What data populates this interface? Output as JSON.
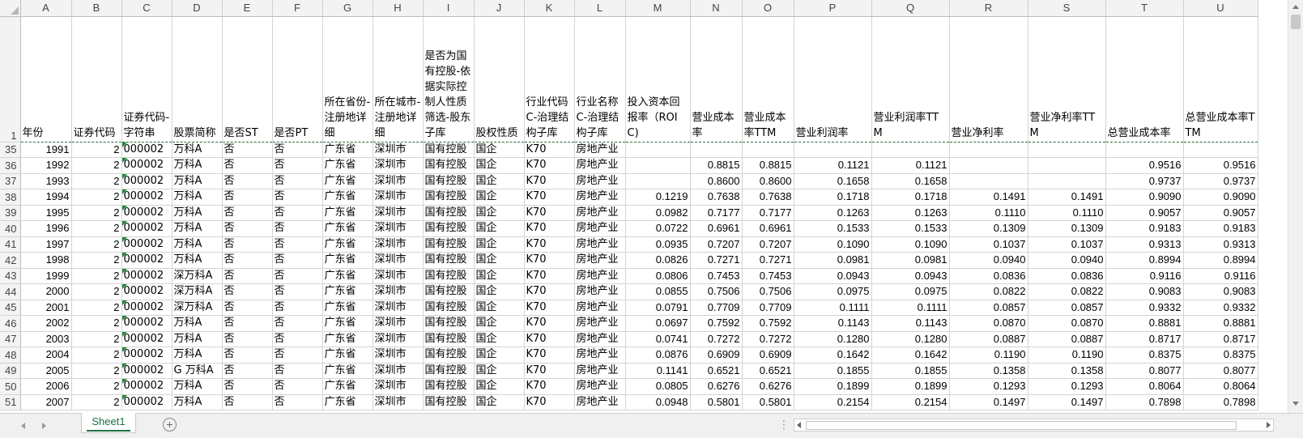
{
  "sheet": {
    "columns": [
      "A",
      "B",
      "C",
      "D",
      "E",
      "F",
      "G",
      "H",
      "I",
      "J",
      "K",
      "L",
      "M",
      "N",
      "O",
      "P",
      "Q",
      "R",
      "S",
      "T",
      "U"
    ],
    "header_row_number": "1",
    "headers": [
      "年份",
      "证券代码",
      "证券代码-字符串",
      "股票简称",
      "是否ST",
      "是否PT",
      "所在省份-注册地详细",
      "所在城市-注册地详细",
      "是否为国有控股-依据实际控制人性质筛选-股东子库",
      "股权性质",
      "行业代码C-治理结构子库",
      "行业名称C-治理结构子库",
      "投入资本回报率（ROIC)",
      "营业成本率",
      "营业成本率TTM",
      "营业利润率",
      "营业利润率TTM",
      "营业净利率",
      "营业净利率TTM",
      "总营业成本率",
      "总营业成本率TTM"
    ],
    "rows": [
      {
        "n": "35",
        "cells": [
          "1991",
          "2",
          "000002",
          "万科A",
          "否",
          "否",
          "广东省",
          "深圳市",
          "国有控股",
          "国企",
          "K70",
          "房地产业",
          "",
          "",
          "",
          "",
          "",
          "",
          "",
          "",
          ""
        ]
      },
      {
        "n": "36",
        "cells": [
          "1992",
          "2",
          "000002",
          "万科A",
          "否",
          "否",
          "广东省",
          "深圳市",
          "国有控股",
          "国企",
          "K70",
          "房地产业",
          "",
          "0.8815",
          "0.8815",
          "0.1121",
          "0.1121",
          "",
          "",
          "0.9516",
          "0.9516"
        ]
      },
      {
        "n": "37",
        "cells": [
          "1993",
          "2",
          "000002",
          "万科A",
          "否",
          "否",
          "广东省",
          "深圳市",
          "国有控股",
          "国企",
          "K70",
          "房地产业",
          "",
          "0.8600",
          "0.8600",
          "0.1658",
          "0.1658",
          "",
          "",
          "0.9737",
          "0.9737"
        ]
      },
      {
        "n": "38",
        "cells": [
          "1994",
          "2",
          "000002",
          "万科A",
          "否",
          "否",
          "广东省",
          "深圳市",
          "国有控股",
          "国企",
          "K70",
          "房地产业",
          "0.1219",
          "0.7638",
          "0.7638",
          "0.1718",
          "0.1718",
          "0.1491",
          "0.1491",
          "0.9090",
          "0.9090"
        ]
      },
      {
        "n": "39",
        "cells": [
          "1995",
          "2",
          "000002",
          "万科A",
          "否",
          "否",
          "广东省",
          "深圳市",
          "国有控股",
          "国企",
          "K70",
          "房地产业",
          "0.0982",
          "0.7177",
          "0.7177",
          "0.1263",
          "0.1263",
          "0.1110",
          "0.1110",
          "0.9057",
          "0.9057"
        ]
      },
      {
        "n": "40",
        "cells": [
          "1996",
          "2",
          "000002",
          "万科A",
          "否",
          "否",
          "广东省",
          "深圳市",
          "国有控股",
          "国企",
          "K70",
          "房地产业",
          "0.0722",
          "0.6961",
          "0.6961",
          "0.1533",
          "0.1533",
          "0.1309",
          "0.1309",
          "0.9183",
          "0.9183"
        ]
      },
      {
        "n": "41",
        "cells": [
          "1997",
          "2",
          "000002",
          "万科A",
          "否",
          "否",
          "广东省",
          "深圳市",
          "国有控股",
          "国企",
          "K70",
          "房地产业",
          "0.0935",
          "0.7207",
          "0.7207",
          "0.1090",
          "0.1090",
          "0.1037",
          "0.1037",
          "0.9313",
          "0.9313"
        ]
      },
      {
        "n": "42",
        "cells": [
          "1998",
          "2",
          "000002",
          "万科A",
          "否",
          "否",
          "广东省",
          "深圳市",
          "国有控股",
          "国企",
          "K70",
          "房地产业",
          "0.0826",
          "0.7271",
          "0.7271",
          "0.0981",
          "0.0981",
          "0.0940",
          "0.0940",
          "0.8994",
          "0.8994"
        ]
      },
      {
        "n": "43",
        "cells": [
          "1999",
          "2",
          "000002",
          "深万科A",
          "否",
          "否",
          "广东省",
          "深圳市",
          "国有控股",
          "国企",
          "K70",
          "房地产业",
          "0.0806",
          "0.7453",
          "0.7453",
          "0.0943",
          "0.0943",
          "0.0836",
          "0.0836",
          "0.9116",
          "0.9116"
        ]
      },
      {
        "n": "44",
        "cells": [
          "2000",
          "2",
          "000002",
          "深万科A",
          "否",
          "否",
          "广东省",
          "深圳市",
          "国有控股",
          "国企",
          "K70",
          "房地产业",
          "0.0855",
          "0.7506",
          "0.7506",
          "0.0975",
          "0.0975",
          "0.0822",
          "0.0822",
          "0.9083",
          "0.9083"
        ]
      },
      {
        "n": "45",
        "cells": [
          "2001",
          "2",
          "000002",
          "深万科A",
          "否",
          "否",
          "广东省",
          "深圳市",
          "国有控股",
          "国企",
          "K70",
          "房地产业",
          "0.0791",
          "0.7709",
          "0.7709",
          "0.1111",
          "0.1111",
          "0.0857",
          "0.0857",
          "0.9332",
          "0.9332"
        ]
      },
      {
        "n": "46",
        "cells": [
          "2002",
          "2",
          "000002",
          "万科A",
          "否",
          "否",
          "广东省",
          "深圳市",
          "国有控股",
          "国企",
          "K70",
          "房地产业",
          "0.0697",
          "0.7592",
          "0.7592",
          "0.1143",
          "0.1143",
          "0.0870",
          "0.0870",
          "0.8881",
          "0.8881"
        ]
      },
      {
        "n": "47",
        "cells": [
          "2003",
          "2",
          "000002",
          "万科A",
          "否",
          "否",
          "广东省",
          "深圳市",
          "国有控股",
          "国企",
          "K70",
          "房地产业",
          "0.0741",
          "0.7272",
          "0.7272",
          "0.1280",
          "0.1280",
          "0.0887",
          "0.0887",
          "0.8717",
          "0.8717"
        ]
      },
      {
        "n": "48",
        "cells": [
          "2004",
          "2",
          "000002",
          "万科A",
          "否",
          "否",
          "广东省",
          "深圳市",
          "国有控股",
          "国企",
          "K70",
          "房地产业",
          "0.0876",
          "0.6909",
          "0.6909",
          "0.1642",
          "0.1642",
          "0.1190",
          "0.1190",
          "0.8375",
          "0.8375"
        ]
      },
      {
        "n": "49",
        "cells": [
          "2005",
          "2",
          "000002",
          "G 万科A",
          "否",
          "否",
          "广东省",
          "深圳市",
          "国有控股",
          "国企",
          "K70",
          "房地产业",
          "0.1141",
          "0.6521",
          "0.6521",
          "0.1855",
          "0.1855",
          "0.1358",
          "0.1358",
          "0.8077",
          "0.8077"
        ]
      },
      {
        "n": "50",
        "cells": [
          "2006",
          "2",
          "000002",
          "万科A",
          "否",
          "否",
          "广东省",
          "深圳市",
          "国有控股",
          "国企",
          "K70",
          "房地产业",
          "0.0805",
          "0.6276",
          "0.6276",
          "0.1899",
          "0.1899",
          "0.1293",
          "0.1293",
          "0.8064",
          "0.8064"
        ]
      },
      {
        "n": "51",
        "cells": [
          "2007",
          "2",
          "000002",
          "万科A",
          "否",
          "否",
          "广东省",
          "深圳市",
          "国有控股",
          "国企",
          "K70",
          "房地产业",
          "0.0948",
          "0.5801",
          "0.5801",
          "0.2154",
          "0.2154",
          "0.1497",
          "0.1497",
          "0.7898",
          "0.7898"
        ]
      }
    ]
  },
  "tabs": {
    "active": "Sheet1",
    "add": "+"
  },
  "statusbar": {
    "split_dots": "⋮"
  }
}
